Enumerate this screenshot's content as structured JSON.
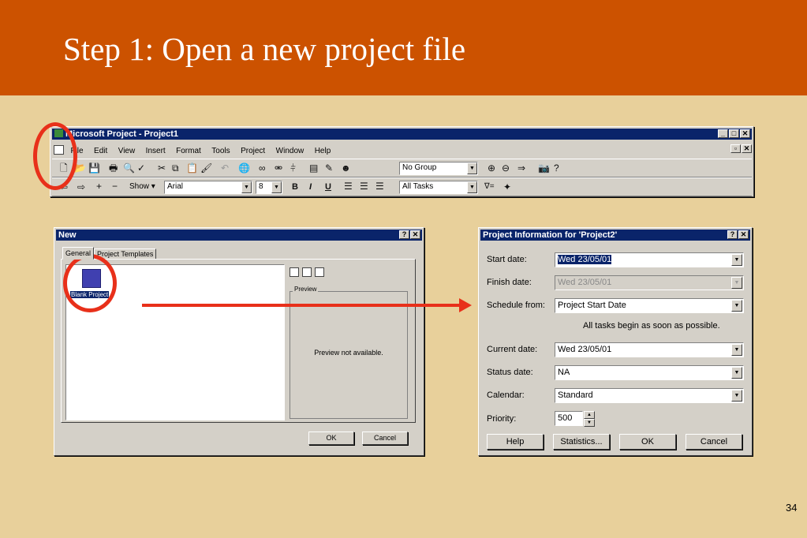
{
  "slide": {
    "title": "Step 1: Open a new project file",
    "page_number": "34"
  },
  "app": {
    "title": "Microsoft Project - Project1",
    "menu": [
      "File",
      "Edit",
      "View",
      "Insert",
      "Format",
      "Tools",
      "Project",
      "Window",
      "Help"
    ],
    "toolbar": {
      "group_value": "No Group",
      "show_label": "Show",
      "font_value": "Arial",
      "size_value": "8",
      "filter_value": "All Tasks"
    }
  },
  "new_dialog": {
    "title": "New",
    "tabs": [
      "General",
      "Project Templates"
    ],
    "item_label": "Blank Project",
    "preview_label": "Preview",
    "preview_text": "Preview not available.",
    "ok": "OK",
    "cancel": "Cancel"
  },
  "info_dialog": {
    "title": "Project Information for 'Project2'",
    "labels": {
      "start_date": "Start date:",
      "finish_date": "Finish date:",
      "schedule_from": "Schedule from:",
      "current_date": "Current date:",
      "status_date": "Status date:",
      "calendar": "Calendar:",
      "priority": "Priority:"
    },
    "values": {
      "start_date": "Wed 23/05/01",
      "finish_date": "Wed 23/05/01",
      "schedule_from": "Project Start Date",
      "current_date": "Wed 23/05/01",
      "status_date": "NA",
      "calendar": "Standard",
      "priority": "500"
    },
    "note": "All tasks begin as soon as possible.",
    "buttons": {
      "help": "Help",
      "statistics": "Statistics...",
      "ok": "OK",
      "cancel": "Cancel"
    }
  },
  "colors": {
    "header": "#cc5200",
    "background": "#e8d09b",
    "annotation": "#e8301a",
    "titlebar": "#0a246a"
  }
}
